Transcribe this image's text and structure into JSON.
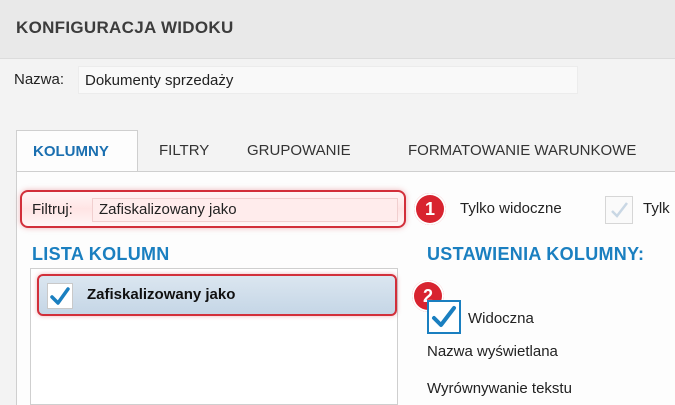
{
  "window": {
    "title": "KONFIGURACJA WIDOKU"
  },
  "name_field": {
    "label": "Nazwa:",
    "value": "Dokumenty sprzedaży"
  },
  "tabs": [
    {
      "label": "KOLUMNY",
      "active": true
    },
    {
      "label": "FILTRY",
      "active": false
    },
    {
      "label": "GRUPOWANIE",
      "active": false
    },
    {
      "label": "FORMATOWANIE WARUNKOWE",
      "active": false
    }
  ],
  "filter": {
    "label": "Filtruj:",
    "value": "Zafiskalizowany jako"
  },
  "options": {
    "only_visible_label": "Tylko widoczne",
    "only_visible_checked": false,
    "second_option_label_visible": "Tylk",
    "second_option_checked": false
  },
  "callouts": {
    "badge1": "1",
    "badge2": "2",
    "color": "#d8232f"
  },
  "columns_list": {
    "heading": "LISTA KOLUMN",
    "items": [
      {
        "label": "Zafiskalizowany jako",
        "checked": true,
        "selected": true
      }
    ]
  },
  "column_settings": {
    "heading": "USTAWIENIA KOLUMNY:",
    "visible_label": "Widoczna",
    "visible_checked": true,
    "display_name_label": "Nazwa wyświetlana",
    "text_align_label": "Wyrównywanie tekstu"
  },
  "colors": {
    "accent": "#1a7fc0",
    "highlight_border": "#d22f3a"
  },
  "icons": {
    "check": "checkmark-icon"
  }
}
